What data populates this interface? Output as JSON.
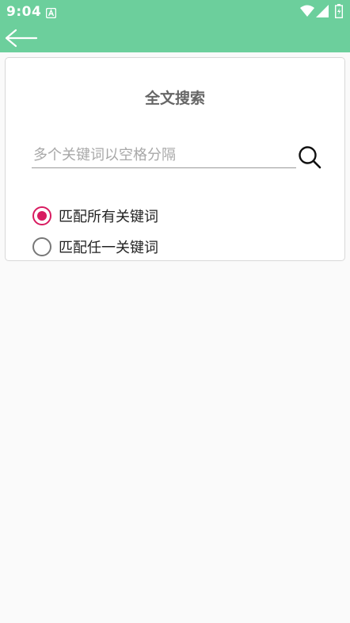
{
  "status_bar": {
    "time": "9:04"
  },
  "icons": {
    "back": "arrow-left-icon",
    "search": "search-icon",
    "notification": "notification-icon",
    "wifi": "wifi-icon",
    "signal": "signal-icon",
    "battery": "battery-icon"
  },
  "colors": {
    "app_bar": "#6ccf9c",
    "radio_checked": "#d81b60",
    "background": "#fafafa"
  },
  "search_card": {
    "title": "全文搜索",
    "input_value": "",
    "input_placeholder": "多个关键词以空格分隔",
    "options": [
      {
        "label": "匹配所有关键词",
        "checked": true
      },
      {
        "label": "匹配任一关键词",
        "checked": false
      }
    ]
  }
}
